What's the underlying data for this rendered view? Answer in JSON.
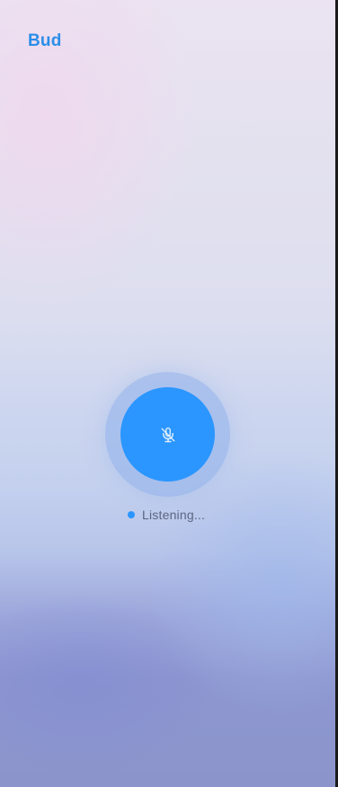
{
  "app": {
    "brand": "Bud"
  },
  "voice": {
    "status_text": "Listening...",
    "mic_icon": "mic-off-icon",
    "accent_color": "#2b96ff"
  }
}
